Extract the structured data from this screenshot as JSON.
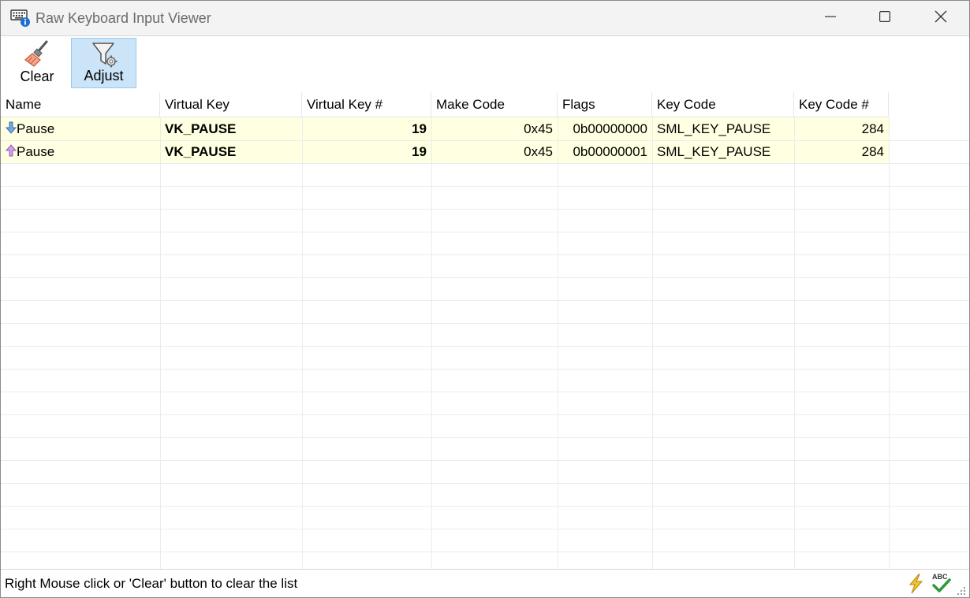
{
  "window": {
    "title": "Raw Keyboard Input Viewer"
  },
  "icons": {
    "app": "keyboard-info-icon",
    "minimize": "minimize-icon",
    "maximize": "maximize-icon",
    "close": "close-icon",
    "clear": "broom-icon",
    "adjust": "filter-gear-icon",
    "key_down": "arrow-down-icon",
    "key_up": "arrow-up-icon",
    "status_lightning": "lightning-icon",
    "status_spellcheck": "abc-check-icon"
  },
  "toolbar": {
    "clear_label": "Clear",
    "adjust_label": "Adjust"
  },
  "table": {
    "columns": [
      "Name",
      "Virtual Key",
      "Virtual Key #",
      "Make Code",
      "Flags",
      "Key Code",
      "Key Code #"
    ],
    "rows": [
      {
        "direction": "down",
        "name": "Pause",
        "virtual_key": "VK_PAUSE",
        "virtual_key_num": "19",
        "make_code": "0x45",
        "flags": "0b00000000",
        "key_code": "SML_KEY_PAUSE",
        "key_code_num": "284"
      },
      {
        "direction": "up",
        "name": "Pause",
        "virtual_key": "VK_PAUSE",
        "virtual_key_num": "19",
        "make_code": "0x45",
        "flags": "0b00000001",
        "key_code": "SML_KEY_PAUSE",
        "key_code_num": "284"
      }
    ]
  },
  "status": {
    "text": "Right Mouse click or 'Clear' button to clear the list"
  },
  "colors": {
    "row_highlight": "#ffffe1",
    "active_button": "#cce4f7",
    "down_arrow": "#5b8fd6",
    "up_arrow": "#b77fd6"
  }
}
